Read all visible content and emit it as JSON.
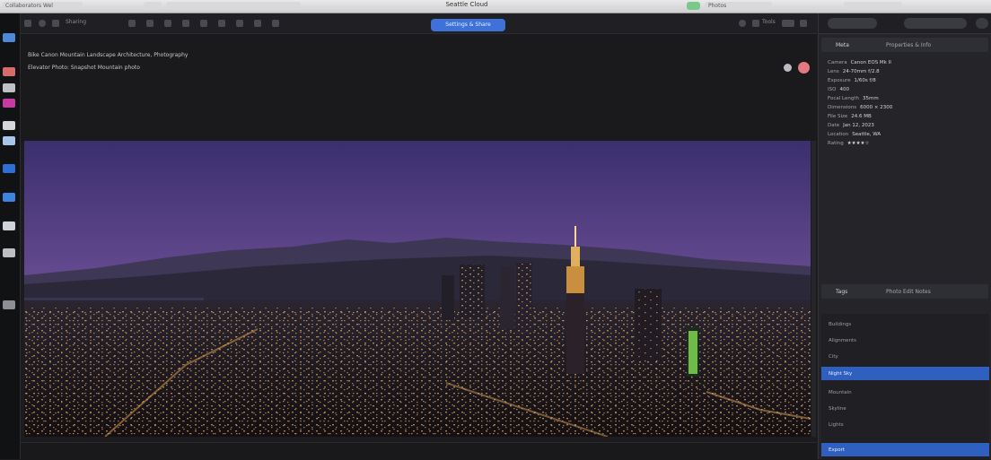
{
  "window": {
    "title": "Seattle Cloud",
    "tabs": [
      "Collaborators Wel",
      "—",
      "Photos"
    ]
  },
  "toolbar": {
    "labels": [
      "Sharing",
      "Tools"
    ],
    "share_button_label": "Settings & Share"
  },
  "info": {
    "line1": "Bike   Canon   Mountain Landscape Architecture, Photography",
    "line2": "Elevator  Photo: Snapshot Mountain  photo"
  },
  "inspector": {
    "section1": {
      "title": "Meta",
      "subtitle": "Properties & Info"
    },
    "properties": [
      {
        "label": "Camera",
        "value": "Canon EOS Mk II"
      },
      {
        "label": "Lens",
        "value": "24-70mm f/2.8"
      },
      {
        "label": "Exposure",
        "value": "1/60s f/8"
      },
      {
        "label": "ISO",
        "value": "400"
      },
      {
        "label": "Focal Length",
        "value": "35mm"
      },
      {
        "label": "Dimensions",
        "value": "6000 × 2300"
      },
      {
        "label": "File Size",
        "value": "24.6 MB"
      },
      {
        "label": "Date",
        "value": "Jan 12, 2023"
      },
      {
        "label": "Location",
        "value": "Seattle, WA"
      },
      {
        "label": "Rating",
        "value": "★★★★☆"
      }
    ],
    "section2": {
      "title": "Tags",
      "subtitle": "Photo Edit Notes"
    },
    "list_items": [
      "Buildings",
      "Alignments",
      "City",
      "Night Sky",
      "Mountain",
      "Skyline",
      "Lights",
      "Export"
    ]
  },
  "colors": {
    "accent": "#3f72d8",
    "sky_top": "#3b2f6e",
    "sky_bottom": "#7a5a9e"
  }
}
